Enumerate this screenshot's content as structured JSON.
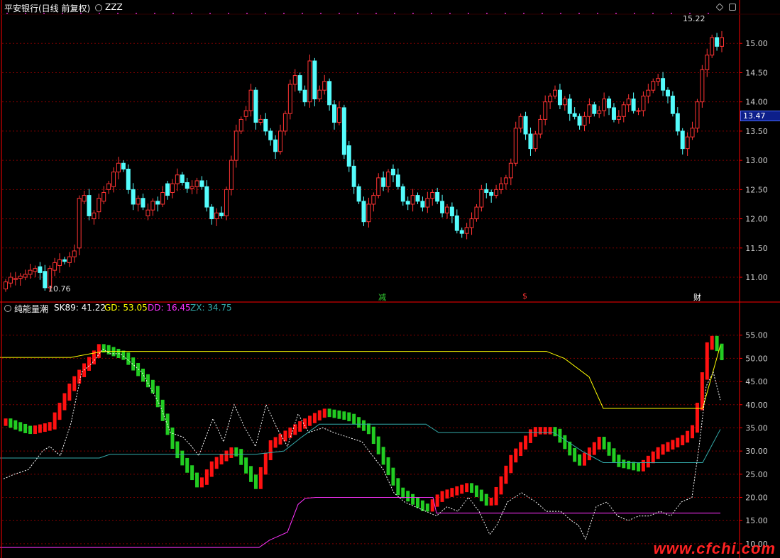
{
  "header": {
    "title": "平安银行(日线 前复权)",
    "indicator": "ZZZ",
    "price_high_label": "15.22",
    "price_low_label": "10.76",
    "current_price_tag": "13.47"
  },
  "markers": [
    {
      "text": "减",
      "color": "#33cc33"
    },
    {
      "text": "$",
      "color": "#ff3333"
    },
    {
      "text": "财",
      "color": "#ffffff"
    }
  ],
  "sub_header": {
    "name": "纯能量潮",
    "sk89_label": "SK89: 41.22",
    "gd_label": "GD: 53.05",
    "dd_label": "DD: 16.45",
    "zx_label": "ZX: 34.75"
  },
  "watermark": "www.cfchi.com",
  "colors": {
    "up": "#ff3333",
    "down": "#54fcfc",
    "gd": "#ffff00",
    "dd": "#ff33ff",
    "zx": "#33aaaa",
    "grid": "#800000",
    "axis": "#ff0000"
  },
  "chart_data": [
    {
      "type": "candlestick",
      "y_ticks": [
        11.0,
        11.5,
        12.0,
        12.5,
        13.0,
        13.5,
        14.0,
        14.5,
        15.0
      ],
      "ylim": [
        10.6,
        15.5
      ],
      "close": [
        10.92,
        11.0,
        10.98,
        11.02,
        11.05,
        11.12,
        11.15,
        11.08,
        10.82,
        11.15,
        11.25,
        11.3,
        11.27,
        11.35,
        11.45,
        12.35,
        12.4,
        12.05,
        12.1,
        12.35,
        12.45,
        12.6,
        12.8,
        12.95,
        12.85,
        12.5,
        12.25,
        12.35,
        12.2,
        12.15,
        12.3,
        12.25,
        12.45,
        12.4,
        12.6,
        12.75,
        12.62,
        12.52,
        12.55,
        12.65,
        12.55,
        12.2,
        12.0,
        12.1,
        12.05,
        12.5,
        13.0,
        13.5,
        13.7,
        13.85,
        14.2,
        13.65,
        13.7,
        13.5,
        13.35,
        13.15,
        13.5,
        13.8,
        14.3,
        14.45,
        14.2,
        14.0,
        14.7,
        14.05,
        14.2,
        14.35,
        13.95,
        13.65,
        13.9,
        13.1,
        12.9,
        12.55,
        12.3,
        11.95,
        12.25,
        12.4,
        12.7,
        12.55,
        12.8,
        12.75,
        12.55,
        12.3,
        12.25,
        12.4,
        12.3,
        12.2,
        12.35,
        12.45,
        12.3,
        12.1,
        12.2,
        12.05,
        11.8,
        11.75,
        11.85,
        12.0,
        12.2,
        12.5,
        12.45,
        12.4,
        12.5,
        12.6,
        12.7,
        12.95,
        13.55,
        13.75,
        13.45,
        13.2,
        13.45,
        13.7,
        14.0,
        14.1,
        14.2,
        13.95,
        14.05,
        13.8,
        13.75,
        13.6,
        13.75,
        13.95,
        13.8,
        13.85,
        14.05,
        13.9,
        13.7,
        13.75,
        13.95,
        14.05,
        13.85,
        13.85,
        14.1,
        14.2,
        14.35,
        14.4,
        14.2,
        14.1,
        13.8,
        13.5,
        13.2,
        13.4,
        13.55,
        14.0,
        14.55,
        14.8,
        15.1,
        14.95,
        15.1
      ],
      "open": [
        10.8,
        10.9,
        10.96,
        10.98,
        11.0,
        11.05,
        11.1,
        11.18,
        11.1,
        10.82,
        11.12,
        11.2,
        11.3,
        11.25,
        11.35,
        11.5,
        12.3,
        12.4,
        12.0,
        12.12,
        12.3,
        12.5,
        12.55,
        12.8,
        12.95,
        12.85,
        12.5,
        12.25,
        12.35,
        12.05,
        12.15,
        12.3,
        12.25,
        12.6,
        12.45,
        12.6,
        12.75,
        12.62,
        12.52,
        12.55,
        12.65,
        12.55,
        12.2,
        12.0,
        12.1,
        12.05,
        12.5,
        13.0,
        13.5,
        13.75,
        13.85,
        14.2,
        13.65,
        13.7,
        13.5,
        13.35,
        13.15,
        13.5,
        13.8,
        14.3,
        14.45,
        14.2,
        14.0,
        14.7,
        14.05,
        14.2,
        14.35,
        13.95,
        13.65,
        13.9,
        13.25,
        12.9,
        12.55,
        12.3,
        11.95,
        12.25,
        12.4,
        12.7,
        12.55,
        12.85,
        12.75,
        12.55,
        12.3,
        12.25,
        12.4,
        12.3,
        12.2,
        12.35,
        12.45,
        12.3,
        12.1,
        12.2,
        12.05,
        11.8,
        11.75,
        11.85,
        12.0,
        12.2,
        12.5,
        12.45,
        12.4,
        12.5,
        12.6,
        12.7,
        12.95,
        13.55,
        13.75,
        13.45,
        13.2,
        13.45,
        13.7,
        14.0,
        14.1,
        14.2,
        13.95,
        14.05,
        13.8,
        13.75,
        13.6,
        13.75,
        13.95,
        13.8,
        13.85,
        14.05,
        13.9,
        13.7,
        13.75,
        13.95,
        14.05,
        13.85,
        13.85,
        14.1,
        14.2,
        14.35,
        14.4,
        14.2,
        14.1,
        13.8,
        13.5,
        13.2,
        13.4,
        13.55,
        14.0,
        14.55,
        14.8,
        15.1,
        14.95
      ]
    },
    {
      "type": "line",
      "name": "纯能量潮",
      "y_ticks": [
        10,
        15,
        20,
        25,
        30,
        35,
        40,
        45,
        50,
        55
      ],
      "ylim": [
        8,
        60
      ],
      "series": [
        {
          "name": "GD",
          "values_points": [
            [
              0,
              50.2
            ],
            [
              100,
              50.2
            ],
            [
              145,
              51.5
            ],
            [
              770,
              51.5
            ],
            [
              795,
              50
            ],
            [
              830,
              46
            ],
            [
              850,
              39.2
            ],
            [
              990,
              39.2
            ],
            [
              1015,
              52.8
            ]
          ]
        },
        {
          "name": "DD",
          "values_points": [
            [
              0,
              9.2
            ],
            [
              365,
              9.2
            ],
            [
              380,
              10.8
            ],
            [
              405,
              12.5
            ],
            [
              420,
              18.5
            ],
            [
              430,
              19.8
            ],
            [
              445,
              20
            ],
            [
              610,
              20
            ],
            [
              615,
              16.6
            ],
            [
              1015,
              16.6
            ]
          ]
        },
        {
          "name": "ZX",
          "values_points": [
            [
              0,
              28.5
            ],
            [
              140,
              28.5
            ],
            [
              155,
              29.3
            ],
            [
              360,
              29.3
            ],
            [
              400,
              30
            ],
            [
              425,
              33
            ],
            [
              450,
              35.8
            ],
            [
              600,
              35.8
            ],
            [
              618,
              34
            ],
            [
              780,
              34
            ],
            [
              820,
              30
            ],
            [
              850,
              27.5
            ],
            [
              990,
              27.5
            ],
            [
              1015,
              34.7
            ]
          ]
        },
        {
          "name": "SK89",
          "values_points": [
            [
              5,
              24
            ],
            [
              20,
              25
            ],
            [
              40,
              26
            ],
            [
              60,
              30
            ],
            [
              70,
              31
            ],
            [
              85,
              29
            ],
            [
              100,
              36
            ],
            [
              115,
              47
            ],
            [
              130,
              49
            ],
            [
              145,
              52
            ],
            [
              155,
              51
            ],
            [
              170,
              51
            ],
            [
              200,
              47
            ],
            [
              225,
              40
            ],
            [
              240,
              34
            ],
            [
              258,
              33
            ],
            [
              270,
              31
            ],
            [
              280,
              29
            ],
            [
              300,
              37
            ],
            [
              315,
              32
            ],
            [
              330,
              40
            ],
            [
              345,
              35
            ],
            [
              360,
              31
            ],
            [
              375,
              40
            ],
            [
              390,
              35
            ],
            [
              405,
              31
            ],
            [
              420,
              38
            ],
            [
              435,
              34
            ],
            [
              455,
              35
            ],
            [
              470,
              34
            ],
            [
              490,
              33
            ],
            [
              510,
              32
            ],
            [
              525,
              29
            ],
            [
              540,
              26
            ],
            [
              555,
              21
            ],
            [
              570,
              19
            ],
            [
              585,
              18
            ],
            [
              600,
              17
            ],
            [
              615,
              16
            ],
            [
              630,
              18
            ],
            [
              645,
              17
            ],
            [
              660,
              20
            ],
            [
              675,
              17
            ],
            [
              690,
              12
            ],
            [
              700,
              14
            ],
            [
              715,
              19
            ],
            [
              735,
              21
            ],
            [
              755,
              19
            ],
            [
              770,
              17
            ],
            [
              790,
              17
            ],
            [
              805,
              15
            ],
            [
              815,
              14
            ],
            [
              825,
              11
            ],
            [
              840,
              18
            ],
            [
              855,
              19
            ],
            [
              870,
              16
            ],
            [
              885,
              15
            ],
            [
              900,
              16
            ],
            [
              915,
              16
            ],
            [
              930,
              17
            ],
            [
              945,
              16
            ],
            [
              960,
              19
            ],
            [
              975,
              20
            ],
            [
              985,
              31
            ],
            [
              995,
              44
            ],
            [
              1005,
              47
            ],
            [
              1015,
              41
            ]
          ]
        }
      ]
    }
  ]
}
